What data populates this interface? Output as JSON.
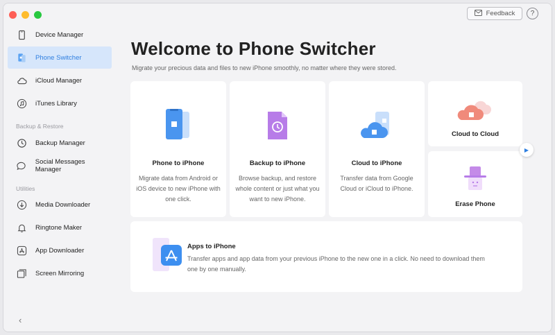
{
  "sidebar": {
    "items": [
      {
        "label": "Device Manager",
        "icon": "phone-icon"
      },
      {
        "label": "Phone Switcher",
        "icon": "phone-switch-icon"
      },
      {
        "label": "iCloud Manager",
        "icon": "cloud-icon"
      },
      {
        "label": "iTunes Library",
        "icon": "music-note-icon"
      },
      {
        "label": "Backup Manager",
        "icon": "clock-icon"
      },
      {
        "label": "Social Messages Manager",
        "icon": "chat-icon"
      },
      {
        "label": "Media Downloader",
        "icon": "download-icon"
      },
      {
        "label": "Ringtone Maker",
        "icon": "bell-icon"
      },
      {
        "label": "App Downloader",
        "icon": "app-store-icon"
      },
      {
        "label": "Screen Mirroring",
        "icon": "screen-mirror-icon"
      }
    ],
    "sections": {
      "backup": "Backup & Restore",
      "utilities": "Utilities"
    },
    "active_index": 1,
    "collapse_glyph": "‹"
  },
  "header": {
    "feedback_label": "Feedback",
    "help_glyph": "?"
  },
  "main": {
    "title": "Welcome to Phone Switcher",
    "subtitle": "Migrate your precious data and files to new iPhone smoothly, no matter where they were stored.",
    "cards": {
      "phone_to_iphone": {
        "title": "Phone to iPhone",
        "desc": "Migrate data from Android or iOS device to new iPhone with one click."
      },
      "backup_to_iphone": {
        "title": "Backup to iPhone",
        "desc": "Browse backup, and restore whole content or just what you want to new iPhone."
      },
      "cloud_to_iphone": {
        "title": "Cloud to iPhone",
        "desc": "Transfer data from Google Cloud or iCloud to iPhone."
      },
      "cloud_to_cloud": {
        "title": "Cloud to Cloud"
      },
      "erase_phone": {
        "title": "Erase Phone"
      },
      "apps_to_iphone": {
        "title": "Apps to iPhone",
        "desc": "Transfer apps and app data from your previous iPhone to the new one in a click. No need to download them one by one manually."
      }
    },
    "next_glyph": "▶"
  },
  "colors": {
    "accent": "#2f7fe0",
    "active_bg": "#d6e6fb"
  }
}
